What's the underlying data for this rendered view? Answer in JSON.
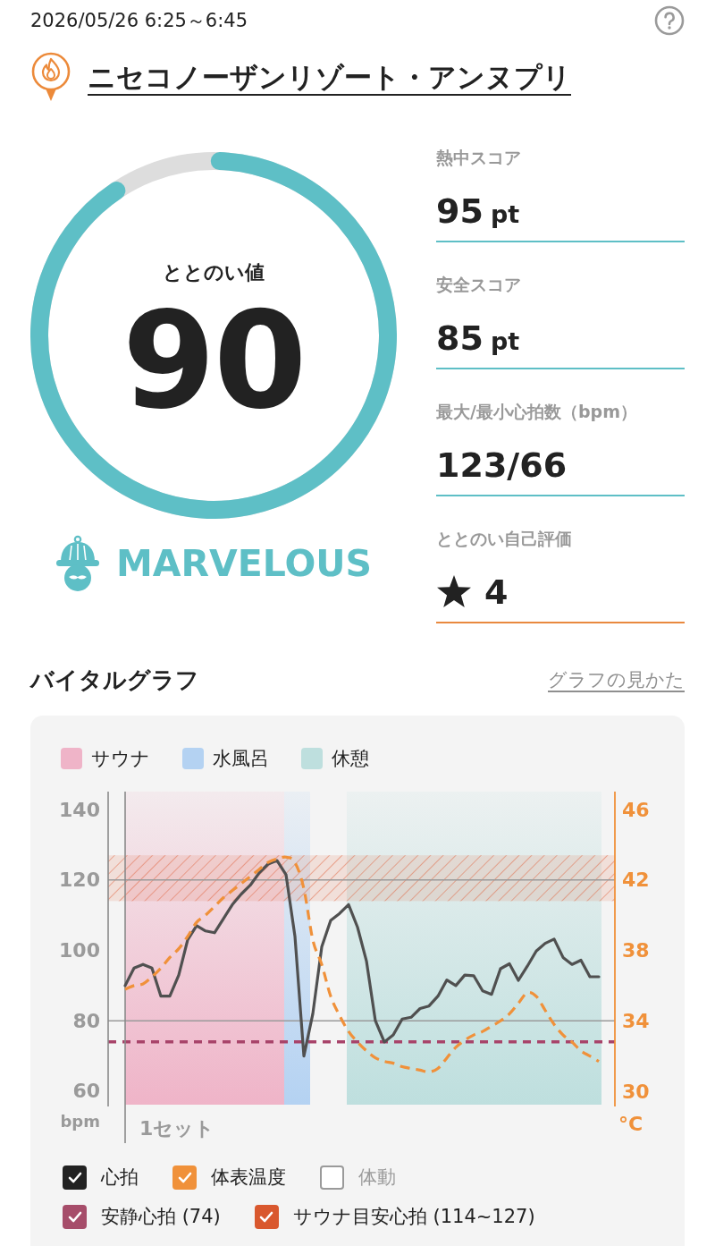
{
  "header": {
    "datetime": "2026/05/26 6:25～6:45"
  },
  "place": {
    "name": "ニセコノーザンリゾート・アンヌプリ"
  },
  "ring": {
    "label": "ととのい値",
    "value": "90"
  },
  "grade": {
    "text": "MARVELOUS"
  },
  "stats": [
    {
      "kind": "score",
      "label": "熱中スコア",
      "value": "95",
      "unit": "pt"
    },
    {
      "kind": "score",
      "label": "安全スコア",
      "value": "85",
      "unit": "pt"
    },
    {
      "kind": "score",
      "label": "最大/最小心拍数（bpm）",
      "value": "123/66"
    },
    {
      "kind": "rating",
      "label": "ととのい自己評価",
      "value": "4"
    }
  ],
  "vital_graph": {
    "title": "バイタルグラフ",
    "link": "グラフの見かた",
    "legend": [
      {
        "label": "サウナ",
        "color": "#efb4c8"
      },
      {
        "label": "水風呂",
        "color": "#b4d2f2"
      },
      {
        "label": "休憩",
        "color": "#bedfde"
      }
    ],
    "chart_data": {
      "type": "line",
      "ylabel": "bpm",
      "y2label": "°C",
      "categories": [
        null,
        null,
        null,
        null,
        null,
        null,
        null,
        null,
        null,
        null,
        null,
        null,
        null,
        null,
        null,
        null,
        null,
        null,
        null,
        null,
        null,
        null,
        null,
        null,
        null,
        null,
        null,
        null,
        null,
        null,
        null,
        null,
        null,
        null,
        null,
        null,
        null,
        null,
        null,
        null,
        null,
        null,
        null,
        null,
        null,
        null,
        null,
        null,
        null,
        null,
        null,
        null,
        null,
        null
      ],
      "ylim": [
        55.68,
        145.08
      ],
      "y2lim": [
        29.14,
        47.02
      ],
      "yticks": [
        140,
        120,
        100,
        80,
        60
      ],
      "y2ticks": [
        46,
        42,
        38,
        34,
        30
      ],
      "series": [
        {
          "color": "#505050",
          "values": [
            90,
            95,
            96,
            95,
            87,
            87,
            93,
            103,
            107,
            105.5,
            105,
            109,
            113,
            116,
            118.5,
            122,
            124.5,
            125.5,
            121.5,
            104,
            70,
            82,
            101,
            108.5,
            110.5,
            113,
            106.6,
            97,
            80,
            74,
            76,
            80.5,
            81,
            83.5,
            84.2,
            87,
            91.6,
            90,
            93,
            92.8,
            88.5,
            87.5,
            94.8,
            96.2,
            91.5,
            95.5,
            99.8,
            102,
            103.2,
            98,
            96,
            97.2,
            92.5,
            92.5
          ]
        },
        {
          "color": "#f0913a",
          "axis": "y2",
          "line_style": "dashed",
          "values": [
            35.8,
            36,
            36.1,
            36.5,
            37,
            37.6,
            38.1,
            38.8,
            39.6,
            40,
            40.5,
            41,
            41.4,
            41.8,
            42.2,
            42.6,
            43,
            43.2,
            43.3,
            43,
            41.5,
            38.6,
            37.2,
            35.4,
            34.3,
            33.4,
            32.8,
            32.3,
            31.9,
            31.7,
            31.6,
            31.4,
            31.3,
            31.2,
            31.1,
            31.3,
            31.9,
            32.5,
            32.9,
            33.2,
            33.4,
            33.7,
            34,
            34.4,
            35,
            35.6,
            35.4,
            34.6,
            33.8,
            33.2,
            32.8,
            32.3,
            32,
            31.7
          ]
        }
      ],
      "bands": [
        {
          "axis": "y",
          "from": 114,
          "to": 127,
          "color": "#e0603a"
        }
      ],
      "ref_lines": [
        {
          "axis": "y",
          "value": 74,
          "color": "#a8446a",
          "line_style": "dashed"
        }
      ]
    },
    "set_label": "1セット",
    "toggle_rows": [
      {
        "items": [
          {
            "label": "心拍",
            "checked": true,
            "color": "#222222"
          },
          {
            "label": "体表温度",
            "checked": true,
            "color": "#f0913a"
          },
          {
            "label": "体動",
            "checked": false,
            "color": "#9a9a9a"
          }
        ]
      },
      {
        "items": [
          {
            "label": "安静心拍 (74)",
            "checked": true,
            "color": "#a64d6a"
          },
          {
            "label": "サウナ目安心拍 (114~127)",
            "checked": true,
            "color": "#d9582e"
          }
        ]
      }
    ]
  }
}
